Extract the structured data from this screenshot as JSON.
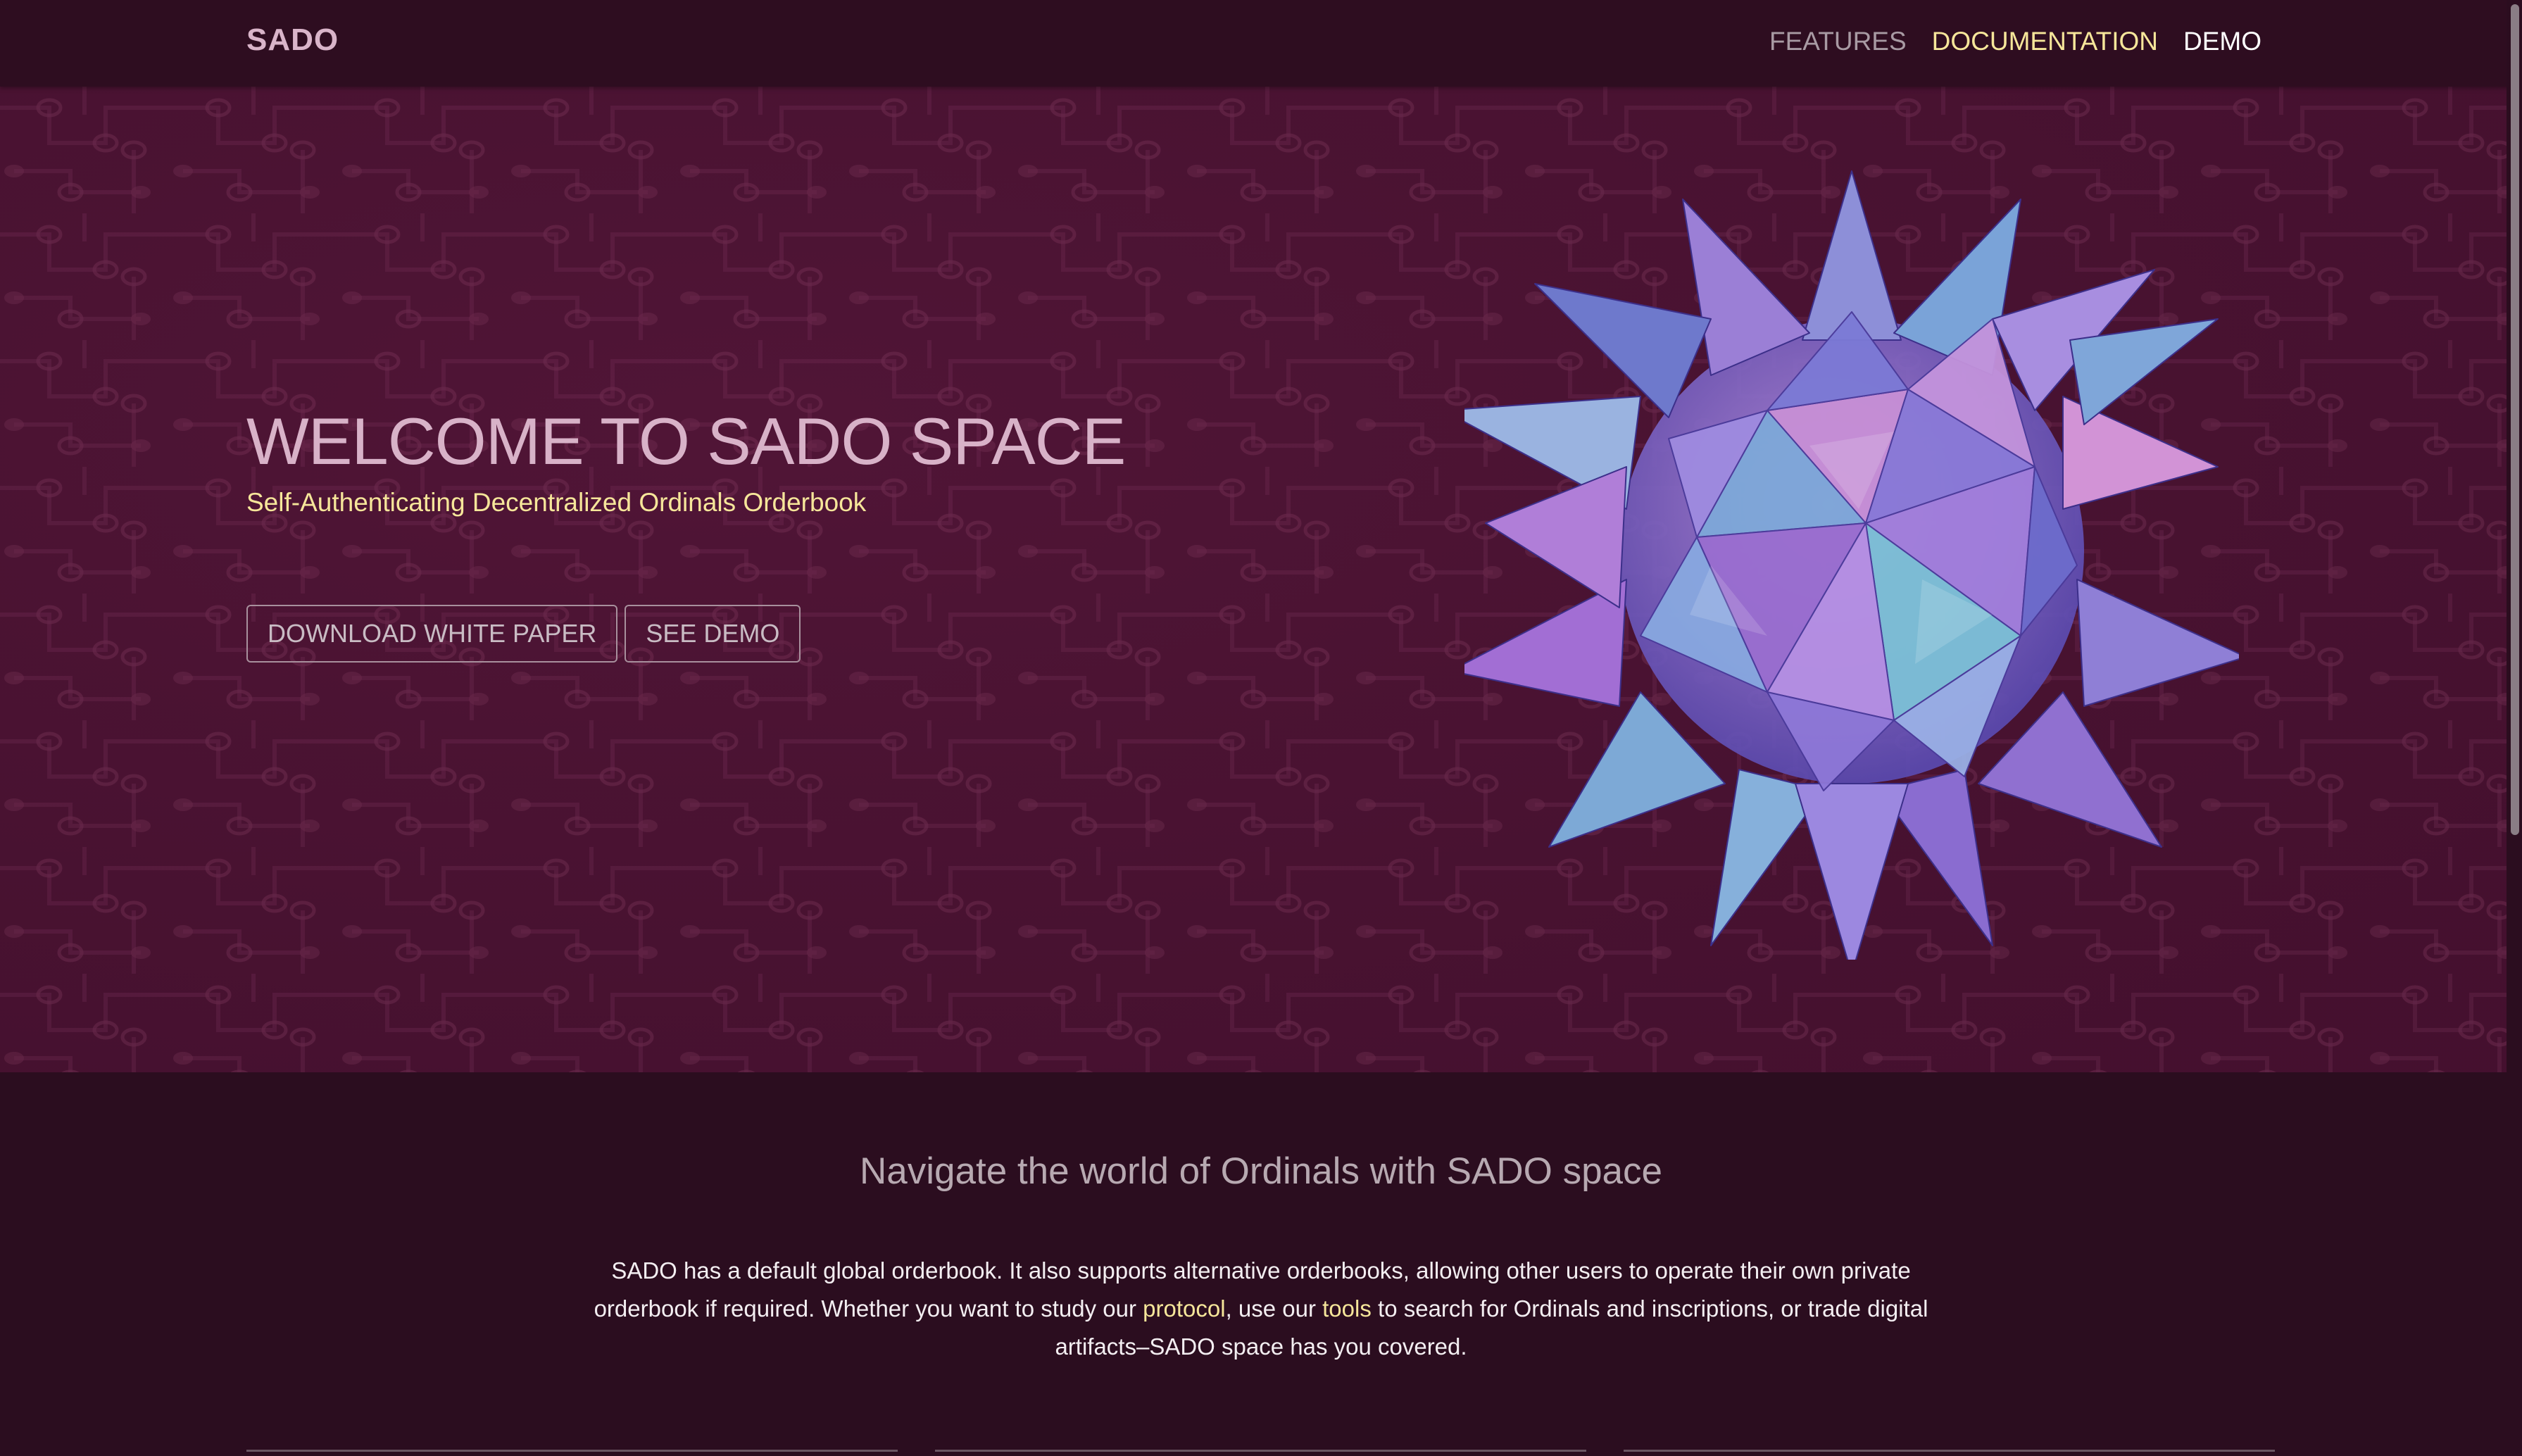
{
  "navbar": {
    "brand": "SADO",
    "links": [
      {
        "label": "FEATURES",
        "color": "#a89aa3"
      },
      {
        "label": "DOCUMENTATION",
        "color": "#f6e69a"
      },
      {
        "label": "DEMO",
        "color": "#ffffff"
      }
    ]
  },
  "hero": {
    "title": "WELCOME TO SADO SPACE",
    "subtitle": "Self-Authenticating Decentralized Ordinals Orderbook",
    "buttons": {
      "white_paper": "DOWNLOAD WHITE PAPER",
      "demo": "SEE DEMO"
    },
    "background_color": "#4a1232",
    "artwork": "stellated-polyhedron-image"
  },
  "intro": {
    "heading": "Navigate the world of Ordinals with SADO space",
    "text_part1": "SADO has a default global orderbook. It also supports alternative orderbooks, allowing other users to operate their own private orderbook if required. Whether you want to study our ",
    "link_protocol": "protocol",
    "text_part2": ", use our ",
    "link_tools": "tools",
    "text_part3": " to search for Ordinals and inscriptions, or trade digital artifacts–SADO space has you covered."
  },
  "colors": {
    "page_bg": "#2b0d1f",
    "accent_yellow": "#f6e69a",
    "title_pink": "#d8b2c8"
  }
}
